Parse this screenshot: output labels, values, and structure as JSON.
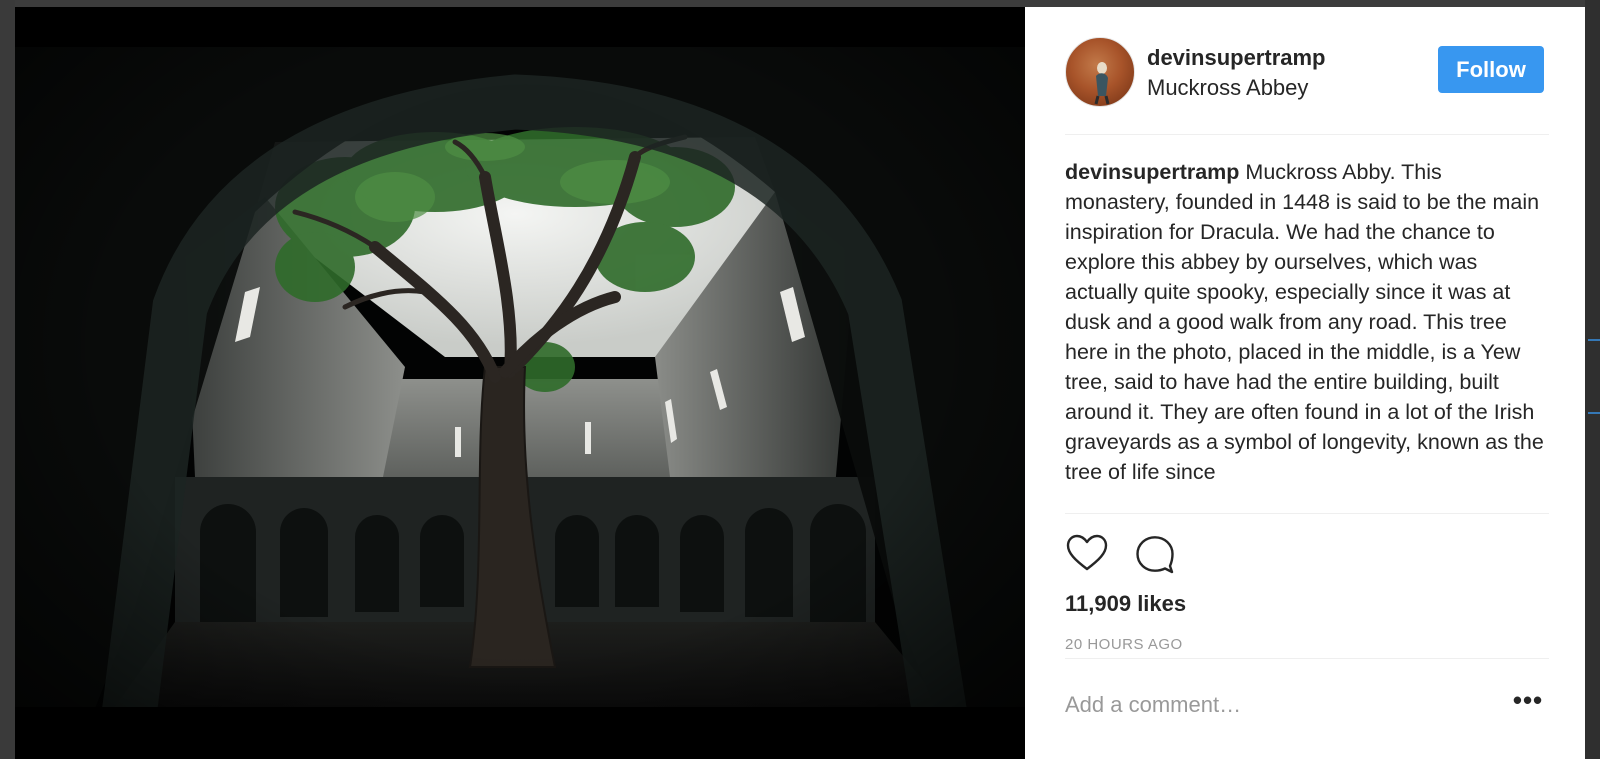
{
  "post": {
    "username": "devinsupertramp",
    "location": "Muckross Abbey",
    "follow_label": "Follow",
    "caption_user": "devinsupertramp",
    "caption_text": " Muckross Abby. This monastery, founded in 1448 is said to be the main inspiration for Dracula. We had the chance to explore this abbey by ourselves, which was actually quite spooky, especially since it was at dusk and a good walk from any road. This tree here in the photo, placed in the middle, is a Yew tree, said to have had the entire building, built around it. They are often found in a lot of the Irish graveyards as a symbol of longevity, known as the tree of life since",
    "likes": "11,909 likes",
    "timestamp": "20 HOURS AGO",
    "comment_placeholder": "Add a comment…",
    "more_label": "•••"
  },
  "icons": {
    "like": "heart-outline-icon",
    "comment": "speech-bubble-icon",
    "more": "ellipsis-icon"
  },
  "colors": {
    "accent": "#3897f0",
    "text": "#262626",
    "muted": "#999999",
    "divider": "#efefef"
  }
}
